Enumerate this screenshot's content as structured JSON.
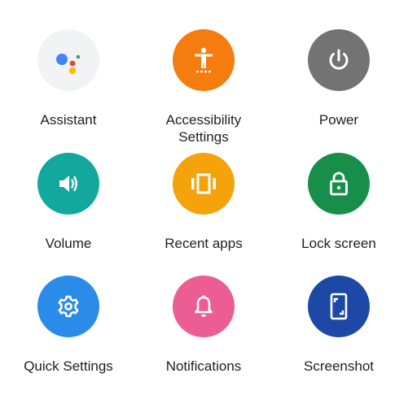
{
  "tiles": [
    {
      "id": "assistant",
      "label": "Assistant",
      "icon": "google-assistant-icon",
      "bg": "#F1F3F4"
    },
    {
      "id": "accessibility",
      "label_lines": [
        "Accessibility",
        "Settings"
      ],
      "icon": "accessibility-icon",
      "bg": "#F57C0E"
    },
    {
      "id": "power",
      "label": "Power",
      "icon": "power-icon",
      "bg": "#737373"
    },
    {
      "id": "volume",
      "label": "Volume",
      "icon": "volume-icon",
      "bg": "#12A89E"
    },
    {
      "id": "recent-apps",
      "label": "Recent apps",
      "icon": "recent-apps-icon",
      "bg": "#F4A30A"
    },
    {
      "id": "lock-screen",
      "label": "Lock screen",
      "icon": "lock-icon",
      "bg": "#178F4A"
    },
    {
      "id": "quick-settings",
      "label": "Quick Settings",
      "icon": "gear-icon",
      "bg": "#2A8CE8"
    },
    {
      "id": "notifications",
      "label": "Notifications",
      "icon": "bell-icon",
      "bg": "#EC5D94"
    },
    {
      "id": "screenshot",
      "label": "Screenshot",
      "icon": "screenshot-icon",
      "bg": "#1E48A5"
    }
  ],
  "assistant_dot_colors": [
    "#4285F4",
    "#EA4335",
    "#FBBC04",
    "#34A853"
  ]
}
